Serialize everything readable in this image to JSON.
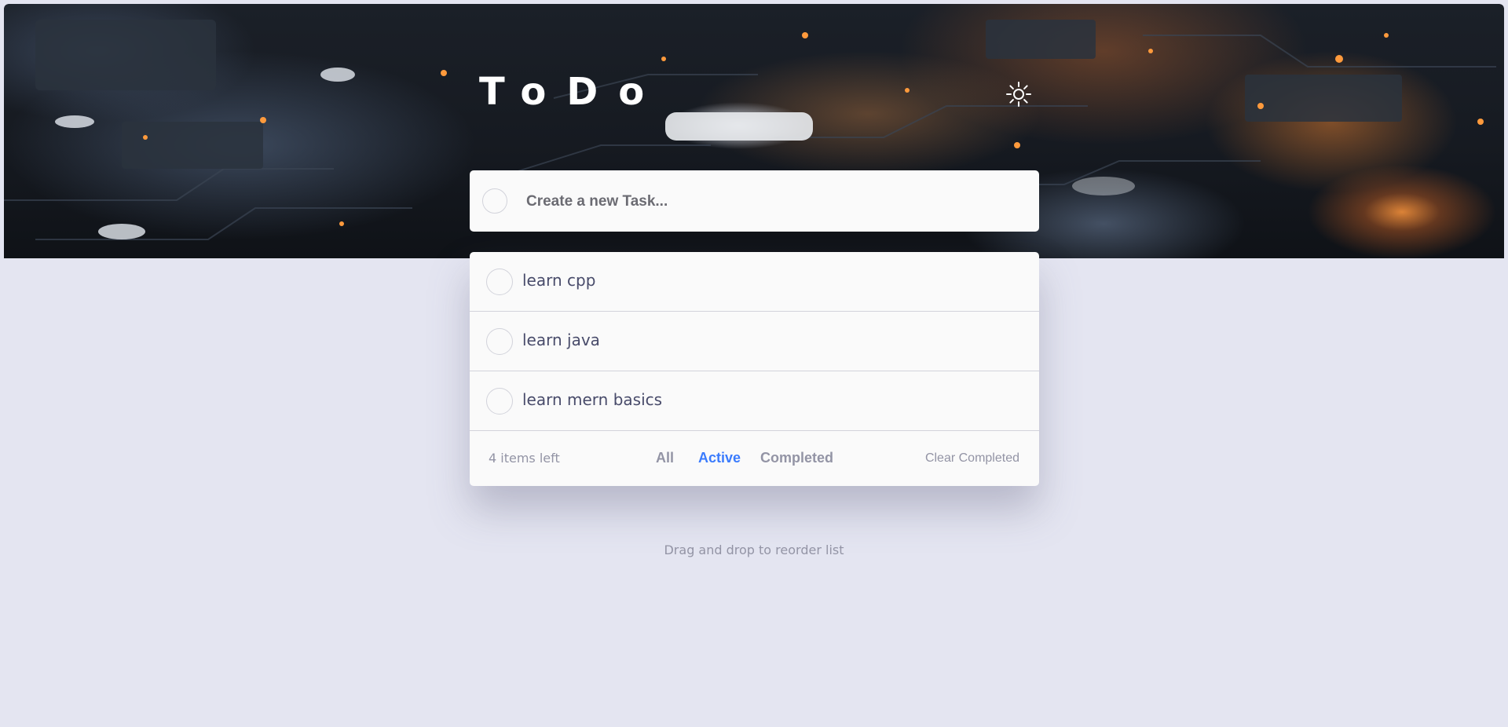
{
  "header": {
    "title": "ToDo",
    "theme_toggle_icon": "sun-icon"
  },
  "new_task": {
    "placeholder": "Create a new Task..."
  },
  "todos": [
    {
      "label": "learn cpp",
      "completed": false
    },
    {
      "label": "learn java",
      "completed": false
    },
    {
      "label": "learn mern basics",
      "completed": false
    }
  ],
  "footer": {
    "items_left": "4 items left",
    "filters": [
      "All",
      "Active",
      "Completed"
    ],
    "active_filter": "Active",
    "clear_label": "Clear Completed"
  },
  "hint": "Drag and drop to reorder list",
  "colors": {
    "background": "#e4e5f1",
    "card": "#fafafa",
    "accent": "#3a7bfd",
    "muted_text": "#9394a5",
    "item_text": "#484b6a"
  }
}
